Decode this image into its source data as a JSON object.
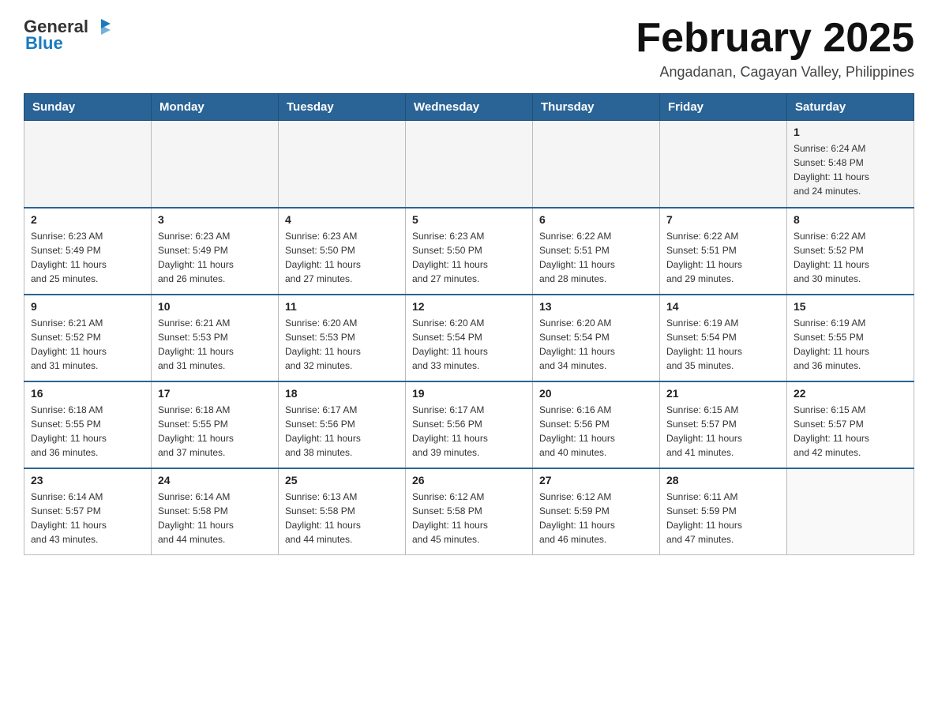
{
  "header": {
    "logo_general": "General",
    "logo_blue": "Blue",
    "month_year": "February 2025",
    "location": "Angadanan, Cagayan Valley, Philippines"
  },
  "days_of_week": [
    "Sunday",
    "Monday",
    "Tuesday",
    "Wednesday",
    "Thursday",
    "Friday",
    "Saturday"
  ],
  "weeks": [
    {
      "days": [
        {
          "num": "",
          "info": ""
        },
        {
          "num": "",
          "info": ""
        },
        {
          "num": "",
          "info": ""
        },
        {
          "num": "",
          "info": ""
        },
        {
          "num": "",
          "info": ""
        },
        {
          "num": "",
          "info": ""
        },
        {
          "num": "1",
          "info": "Sunrise: 6:24 AM\nSunset: 5:48 PM\nDaylight: 11 hours\nand 24 minutes."
        }
      ]
    },
    {
      "days": [
        {
          "num": "2",
          "info": "Sunrise: 6:23 AM\nSunset: 5:49 PM\nDaylight: 11 hours\nand 25 minutes."
        },
        {
          "num": "3",
          "info": "Sunrise: 6:23 AM\nSunset: 5:49 PM\nDaylight: 11 hours\nand 26 minutes."
        },
        {
          "num": "4",
          "info": "Sunrise: 6:23 AM\nSunset: 5:50 PM\nDaylight: 11 hours\nand 27 minutes."
        },
        {
          "num": "5",
          "info": "Sunrise: 6:23 AM\nSunset: 5:50 PM\nDaylight: 11 hours\nand 27 minutes."
        },
        {
          "num": "6",
          "info": "Sunrise: 6:22 AM\nSunset: 5:51 PM\nDaylight: 11 hours\nand 28 minutes."
        },
        {
          "num": "7",
          "info": "Sunrise: 6:22 AM\nSunset: 5:51 PM\nDaylight: 11 hours\nand 29 minutes."
        },
        {
          "num": "8",
          "info": "Sunrise: 6:22 AM\nSunset: 5:52 PM\nDaylight: 11 hours\nand 30 minutes."
        }
      ]
    },
    {
      "days": [
        {
          "num": "9",
          "info": "Sunrise: 6:21 AM\nSunset: 5:52 PM\nDaylight: 11 hours\nand 31 minutes."
        },
        {
          "num": "10",
          "info": "Sunrise: 6:21 AM\nSunset: 5:53 PM\nDaylight: 11 hours\nand 31 minutes."
        },
        {
          "num": "11",
          "info": "Sunrise: 6:20 AM\nSunset: 5:53 PM\nDaylight: 11 hours\nand 32 minutes."
        },
        {
          "num": "12",
          "info": "Sunrise: 6:20 AM\nSunset: 5:54 PM\nDaylight: 11 hours\nand 33 minutes."
        },
        {
          "num": "13",
          "info": "Sunrise: 6:20 AM\nSunset: 5:54 PM\nDaylight: 11 hours\nand 34 minutes."
        },
        {
          "num": "14",
          "info": "Sunrise: 6:19 AM\nSunset: 5:54 PM\nDaylight: 11 hours\nand 35 minutes."
        },
        {
          "num": "15",
          "info": "Sunrise: 6:19 AM\nSunset: 5:55 PM\nDaylight: 11 hours\nand 36 minutes."
        }
      ]
    },
    {
      "days": [
        {
          "num": "16",
          "info": "Sunrise: 6:18 AM\nSunset: 5:55 PM\nDaylight: 11 hours\nand 36 minutes."
        },
        {
          "num": "17",
          "info": "Sunrise: 6:18 AM\nSunset: 5:55 PM\nDaylight: 11 hours\nand 37 minutes."
        },
        {
          "num": "18",
          "info": "Sunrise: 6:17 AM\nSunset: 5:56 PM\nDaylight: 11 hours\nand 38 minutes."
        },
        {
          "num": "19",
          "info": "Sunrise: 6:17 AM\nSunset: 5:56 PM\nDaylight: 11 hours\nand 39 minutes."
        },
        {
          "num": "20",
          "info": "Sunrise: 6:16 AM\nSunset: 5:56 PM\nDaylight: 11 hours\nand 40 minutes."
        },
        {
          "num": "21",
          "info": "Sunrise: 6:15 AM\nSunset: 5:57 PM\nDaylight: 11 hours\nand 41 minutes."
        },
        {
          "num": "22",
          "info": "Sunrise: 6:15 AM\nSunset: 5:57 PM\nDaylight: 11 hours\nand 42 minutes."
        }
      ]
    },
    {
      "days": [
        {
          "num": "23",
          "info": "Sunrise: 6:14 AM\nSunset: 5:57 PM\nDaylight: 11 hours\nand 43 minutes."
        },
        {
          "num": "24",
          "info": "Sunrise: 6:14 AM\nSunset: 5:58 PM\nDaylight: 11 hours\nand 44 minutes."
        },
        {
          "num": "25",
          "info": "Sunrise: 6:13 AM\nSunset: 5:58 PM\nDaylight: 11 hours\nand 44 minutes."
        },
        {
          "num": "26",
          "info": "Sunrise: 6:12 AM\nSunset: 5:58 PM\nDaylight: 11 hours\nand 45 minutes."
        },
        {
          "num": "27",
          "info": "Sunrise: 6:12 AM\nSunset: 5:59 PM\nDaylight: 11 hours\nand 46 minutes."
        },
        {
          "num": "28",
          "info": "Sunrise: 6:11 AM\nSunset: 5:59 PM\nDaylight: 11 hours\nand 47 minutes."
        },
        {
          "num": "",
          "info": ""
        }
      ]
    }
  ]
}
